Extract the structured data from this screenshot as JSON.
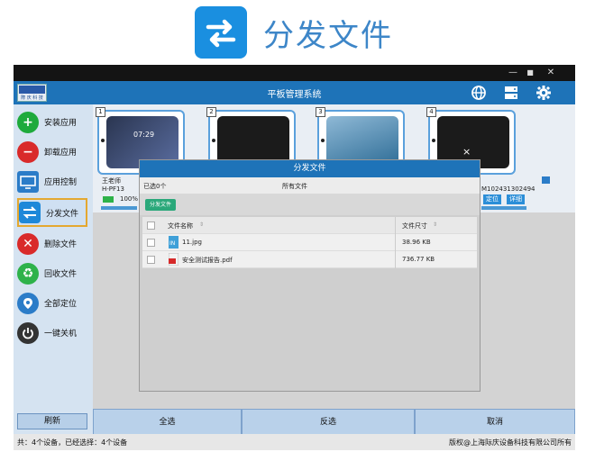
{
  "banner": {
    "title": "分发文件",
    "icon": "arrows-swap-icon"
  },
  "window": {
    "app_title": "平板管理系统",
    "controls": {
      "minimize": "—",
      "maximize": "■",
      "close": "✕"
    },
    "logo_lines": [
      "際 庆  科 技"
    ],
    "header_icons": [
      "globe-icon",
      "server-icon",
      "gear-icon"
    ]
  },
  "sidebar": {
    "items": [
      {
        "label": "安装应用",
        "icon": "plus-circle-icon",
        "color": "#1eaa3c"
      },
      {
        "label": "卸载应用",
        "icon": "minus-circle-icon",
        "color": "#d92a2a"
      },
      {
        "label": "应用控制",
        "icon": "computer-icon",
        "color": "#2b7cc8"
      },
      {
        "label": "分发文件",
        "icon": "arrows-swap-icon",
        "color": "#1e88d9",
        "active": true
      },
      {
        "label": "删除文件",
        "icon": "x-circle-icon",
        "color": "#d92a2a"
      },
      {
        "label": "回收文件",
        "icon": "recycle-icon",
        "color": "#2eb24a"
      },
      {
        "label": "全部定位",
        "icon": "location-icon",
        "color": "#2b7cc8"
      },
      {
        "label": "一键关机",
        "icon": "power-icon",
        "color": "#333333"
      }
    ],
    "refresh": "刷新"
  },
  "tablets": [
    {
      "num": "1",
      "clock": "07:29"
    },
    {
      "num": "2"
    },
    {
      "num": "3"
    },
    {
      "num": "4"
    }
  ],
  "device_info": {
    "name": "王老师",
    "id": "H-PF13",
    "battery": "100%",
    "serial_partial": "M102431302494",
    "locate": "定位",
    "details": "详细"
  },
  "bottom_buttons": {
    "select_all": "全选",
    "invert": "反选",
    "cancel": "取消"
  },
  "status": {
    "left": "共：4个设备，已经选择：4个设备",
    "right": "版权@上海际庆设备科技有限公司所有"
  },
  "modal": {
    "title": "分发文件",
    "close": "×",
    "selected": "已选0个",
    "all_files": "所有文件",
    "send_button": "分发文件",
    "columns": {
      "name": "文件名称",
      "size": "文件尺寸"
    },
    "files": [
      {
        "name": "11.jpg",
        "size": "38.96 KB",
        "icon": "image-file-icon"
      },
      {
        "name": "安全测试报告.pdf",
        "size": "736.77 KB",
        "icon": "pdf-file-icon"
      }
    ]
  }
}
